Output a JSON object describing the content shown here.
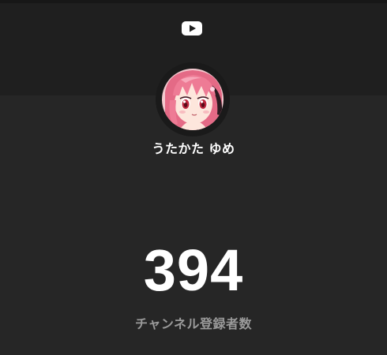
{
  "header": {
    "logo_icon": "youtube-play-icon",
    "logo_color": "#ffffff"
  },
  "channel": {
    "avatar_icon": "anime-character-avatar",
    "name": "うたかた ゆめ"
  },
  "subscribers": {
    "count": "394",
    "label": "チャンネル登録者数"
  },
  "colors": {
    "background": "#262626",
    "header_background": "#1f1f1f",
    "text_primary": "#ffffff",
    "text_secondary": "#9a9a9a"
  }
}
